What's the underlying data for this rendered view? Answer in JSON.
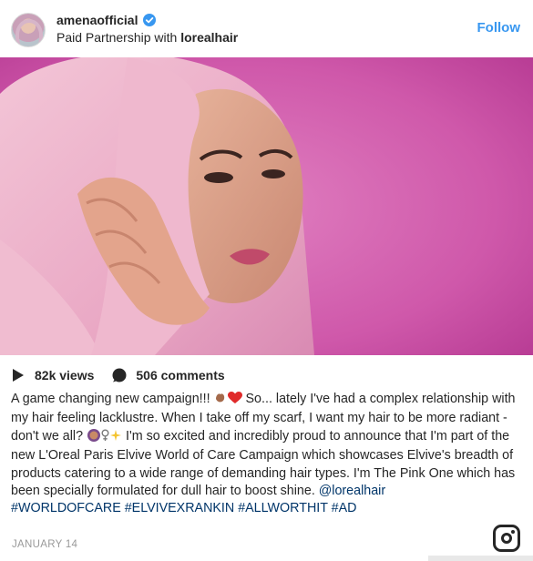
{
  "header": {
    "username": "amenaofficial",
    "partnership_prefix": "Paid Partnership with ",
    "partner": "lorealhair",
    "follow_label": "Follow"
  },
  "stats": {
    "views": "82k views",
    "comments": "506 comments"
  },
  "caption": {
    "line1": "A game changing new campaign!!! ",
    "line2": " So... lately I've had a complex relationship with my hair feeling lacklustre. When I take off my scarf, I want my hair to be more radiant - don't we all? ",
    "line3": " I'm so excited and incredibly proud to announce that I'm part of the new L'Oreal Paris Elvive World of Care Campaign which showcases Elvive's breadth of products catering to a wide range of demanding hair types. I'm The Pink One which has been specially formulated for dull hair to boost shine. ",
    "mention": "@lorealhair",
    "hashtags": "#WORLDOFCARE #ELVIVEXRANKIN #ALLWORTHIT #AD"
  },
  "date": "JANUARY 14",
  "icons": {
    "avatar": "avatar",
    "verified": "verified-badge-icon",
    "views": "play-icon",
    "comments": "comment-bubble-icon",
    "brand": "instagram-logo-icon"
  },
  "colors": {
    "link": "#003569",
    "follow": "#3897f0",
    "verified": "#3897f0",
    "photo_background": "#d064ad"
  }
}
